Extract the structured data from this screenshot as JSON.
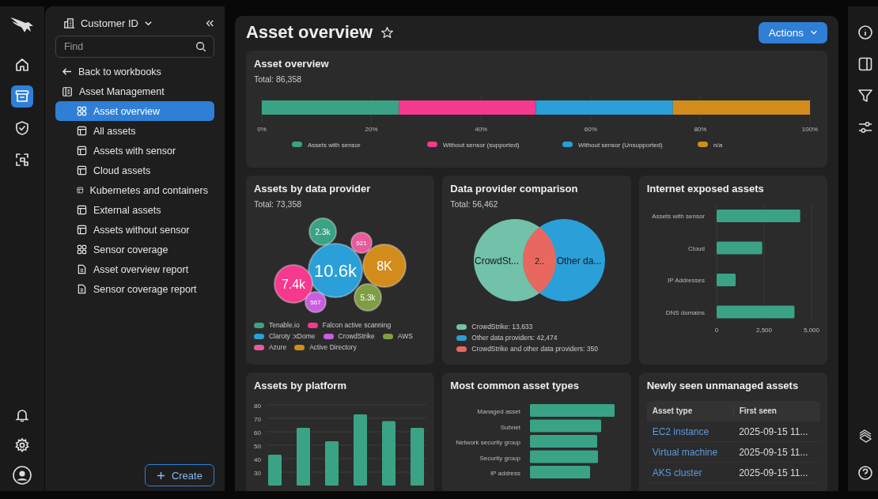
{
  "rail": {
    "top": [
      {
        "kind": "home",
        "selected": false
      },
      {
        "kind": "archive",
        "selected": true
      },
      {
        "kind": "shield",
        "selected": false
      },
      {
        "kind": "scan",
        "selected": false
      }
    ],
    "bottom": [
      {
        "kind": "bell"
      },
      {
        "kind": "gear"
      },
      {
        "kind": "avatar"
      }
    ]
  },
  "sidebar": {
    "workspace": "Customer ID",
    "search": {
      "placeholder": "Find"
    },
    "back": "Back to workbooks",
    "group": "Asset Management",
    "items": [
      {
        "label": "Asset overview",
        "kind": "dashboard",
        "selected": true
      },
      {
        "label": "All assets",
        "kind": "table",
        "selected": false
      },
      {
        "label": "Assets with sensor",
        "kind": "table",
        "selected": false
      },
      {
        "label": "Cloud assets",
        "kind": "table",
        "selected": false
      },
      {
        "label": "Kubernetes and containers",
        "kind": "table",
        "selected": false
      },
      {
        "label": "External assets",
        "kind": "table",
        "selected": false
      },
      {
        "label": "Assets without sensor",
        "kind": "table",
        "selected": false
      },
      {
        "label": "Sensor coverage",
        "kind": "dashboard",
        "selected": false
      },
      {
        "label": "Asset overview report",
        "kind": "report",
        "selected": false
      },
      {
        "label": "Sensor coverage report",
        "kind": "report",
        "selected": false
      }
    ],
    "create": "Create"
  },
  "page": {
    "title": "Asset overview",
    "starred": false,
    "actions": "Actions"
  },
  "overview": {
    "title": "Asset overview",
    "total": "Total: 86,358",
    "chart_data": {
      "type": "bar",
      "orientation": "horizontal",
      "stacked": true,
      "grid": true,
      "legend": true,
      "xlim": [
        0,
        100
      ],
      "series": [
        {
          "name": "Assets with sensor",
          "color": "#3aa385",
          "values": [
            25
          ]
        },
        {
          "name": "Without sensor (supported)",
          "color": "#f5398f",
          "values": [
            25
          ]
        },
        {
          "name": "Without sensor (Unsupported)",
          "color": "#2a9fd8",
          "values": [
            25
          ]
        },
        {
          "name": "n/a",
          "color": "#d18c1c",
          "values": [
            25
          ]
        }
      ],
      "xticks": [
        {
          "value": 0,
          "label": "0%"
        },
        {
          "value": 20,
          "label": "20%"
        },
        {
          "value": 40,
          "label": "40%"
        },
        {
          "value": 60,
          "label": "60%"
        },
        {
          "value": 80,
          "label": "80%"
        },
        {
          "value": 100,
          "label": "100%"
        }
      ]
    }
  },
  "provider": {
    "title": "Assets by data provider",
    "total": "Total: 73,358",
    "bubbles": [
      {
        "label": "2.3k",
        "color": "#3aa385"
      },
      {
        "label": "521",
        "color": "#e85a9c"
      },
      {
        "label": "10.6k",
        "color": "#2a9fd8"
      },
      {
        "label": "8K",
        "color": "#d18c1c"
      },
      {
        "label": "7.4k",
        "color": "#f5398f"
      },
      {
        "label": "567",
        "color": "#c95ee0"
      },
      {
        "label": "5.3k",
        "color": "#7f9d45"
      }
    ],
    "legend": [
      {
        "label": "Tenable.io",
        "color": "#3aa385"
      },
      {
        "label": "Falcon active scanning",
        "color": "#f5398f"
      },
      {
        "label": "Claroty :xDome",
        "color": "#2a9fd8"
      },
      {
        "label": "CrowdStrike",
        "color": "#c95ee0"
      },
      {
        "label": "AWS",
        "color": "#7f9d45"
      },
      {
        "label": "Azure",
        "color": "#e85a9c"
      },
      {
        "label": "Active Directory",
        "color": "#d18c1c"
      }
    ]
  },
  "comparison": {
    "title": "Data provider comparison",
    "total": "Total: 56,462",
    "venn": [
      {
        "label": "CrowdSt...",
        "color": "#72c1a9"
      },
      {
        "label": "2..",
        "color": "#e8685f"
      },
      {
        "label": "Other da...",
        "color": "#2a9fd8"
      }
    ],
    "legend": [
      {
        "label": "CrowdStrike: 13,633",
        "color": "#72c1a9"
      },
      {
        "label": "Other data providers: 42,474",
        "color": "#2a9fd8"
      },
      {
        "label": "CrowdStrike and other data providers: 350",
        "color": "#e8685f"
      }
    ]
  },
  "exposed": {
    "title": "Internet exposed assets",
    "chart_data": {
      "type": "bar",
      "orientation": "horizontal",
      "grid": true,
      "categories": [
        "Assets with sensor",
        "Cloud",
        "IP Addresses",
        "DNS domains"
      ],
      "values": [
        4400,
        2400,
        1000,
        4100
      ],
      "xlim": [
        0,
        5000
      ],
      "xticks": [
        {
          "value": 0,
          "label": "0"
        },
        {
          "value": 2500,
          "label": "2,500"
        },
        {
          "value": 5000,
          "label": "5,000"
        }
      ]
    }
  },
  "platform": {
    "title": "Assets by platform",
    "chart_data": {
      "type": "bar",
      "orientation": "vertical",
      "grid": true,
      "categories": [
        null,
        null,
        null,
        null,
        null,
        null
      ],
      "values": [
        43,
        63,
        53,
        73,
        68,
        63
      ],
      "ylim": [
        20,
        80
      ],
      "yticks": [
        30,
        40,
        50,
        60,
        70,
        80
      ]
    }
  },
  "types": {
    "title": "Most common asset types",
    "rows": [
      {
        "label": "Managed asset"
      },
      {
        "label": "Subnet"
      },
      {
        "label": "Network security group"
      },
      {
        "label": "Security group"
      },
      {
        "label": "IP address"
      }
    ]
  },
  "unmanaged": {
    "title": "Newly seen unmanaged assets",
    "columns": [
      "Asset type",
      "First seen"
    ],
    "rows": [
      [
        "EC2 instance",
        "2025-09-15 11..."
      ],
      [
        "Virtual machine",
        "2025-09-15 11..."
      ],
      [
        "AKS cluster",
        "2025-09-15 11..."
      ]
    ]
  },
  "right_rail": [
    {
      "kind": "info"
    },
    {
      "kind": "panel"
    },
    {
      "kind": "filter"
    },
    {
      "kind": "sliders"
    }
  ],
  "right_rail_bottom": [
    {
      "kind": "stack"
    },
    {
      "kind": "help"
    }
  ]
}
